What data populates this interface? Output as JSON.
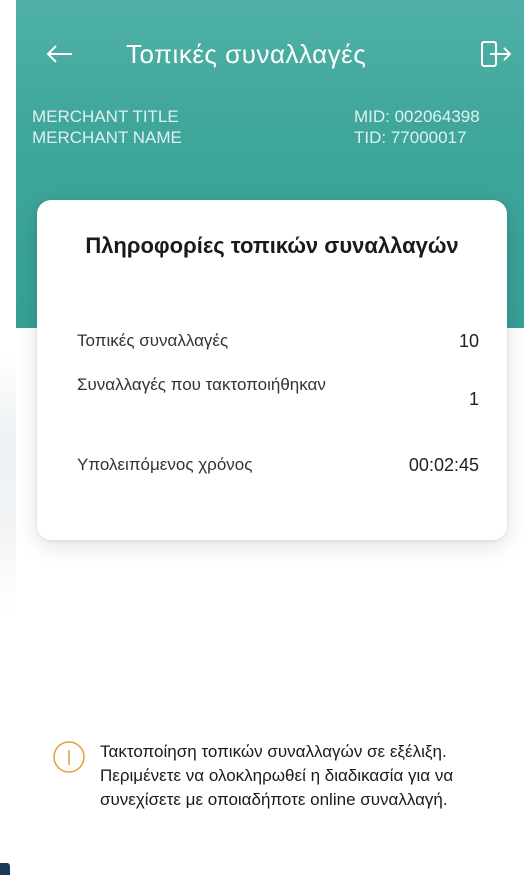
{
  "header": {
    "title": "Τοπικές συναλλαγές",
    "back_icon": "arrow-left-icon",
    "logout_icon": "logout-icon",
    "merchant_title": "MERCHANT TITLE",
    "merchant_name": "MERCHANT NAME",
    "mid": "MID: 002064398",
    "tid": "TID: 77000017"
  },
  "card": {
    "title": "Πληροφορίες τοπικών συναλλαγών",
    "rows": [
      {
        "label": "Τοπικές συναλλαγές",
        "value": "10"
      },
      {
        "label": "Συναλλαγές που τακτοποιήθηκαν",
        "value": "1"
      },
      {
        "label": "Υπολειπόμενος χρόνος",
        "value": "00:02:45"
      }
    ]
  },
  "notice": {
    "icon": "info-icon",
    "text": "Τακτοποίηση τοπικών συναλλαγών σε εξέλιξη. Περιμένετε να ολοκληρωθεί η διαδικασία για να συνεχίσετε με οποιαδήποτε online συναλλαγή."
  },
  "colors": {
    "header_bg": "#3fa69a",
    "header_text": "#ffffff",
    "card_bg": "#ffffff",
    "notice_icon": "#e0a23b"
  }
}
